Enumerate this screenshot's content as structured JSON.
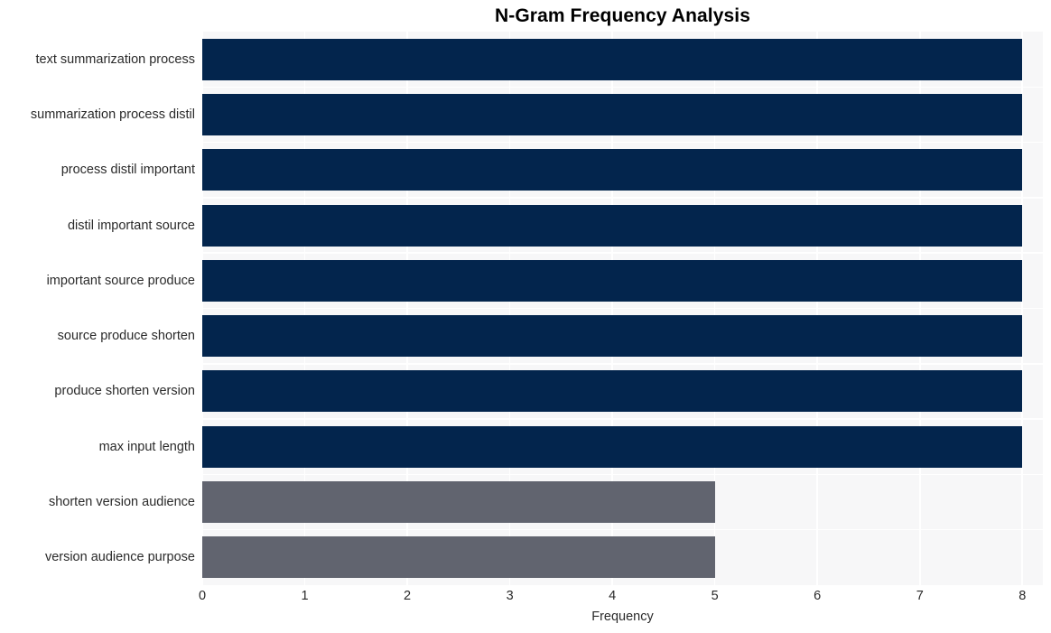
{
  "chart_data": {
    "type": "bar",
    "orientation": "horizontal",
    "title": "N-Gram Frequency Analysis",
    "xlabel": "Frequency",
    "ylabel": "",
    "xlim": [
      0,
      8.2
    ],
    "xticks": [
      0,
      1,
      2,
      3,
      4,
      5,
      6,
      7,
      8
    ],
    "xtick_labels": [
      "0",
      "1",
      "2",
      "3",
      "4",
      "5",
      "6",
      "7",
      "8"
    ],
    "grid": true,
    "legend": "none",
    "categories": [
      "text summarization process",
      "summarization process distil",
      "process distil important",
      "distil important source",
      "important source produce",
      "source produce shorten",
      "produce shorten version",
      "max input length",
      "shorten version audience",
      "version audience purpose"
    ],
    "values": [
      8,
      8,
      8,
      8,
      8,
      8,
      8,
      8,
      5,
      5
    ],
    "bar_colors": [
      "#03254d",
      "#03254d",
      "#03254d",
      "#03254d",
      "#03254d",
      "#03254d",
      "#03254d",
      "#03254d",
      "#61646f",
      "#61646f"
    ]
  },
  "style": {
    "plot_background": "#f7f7f8",
    "page_background": "#ffffff",
    "gridline_color": "#ffffff",
    "primary_bar_color": "#03254d",
    "secondary_bar_color": "#61646f",
    "title_color": "#000000",
    "tick_color": "#2a2a2a"
  }
}
